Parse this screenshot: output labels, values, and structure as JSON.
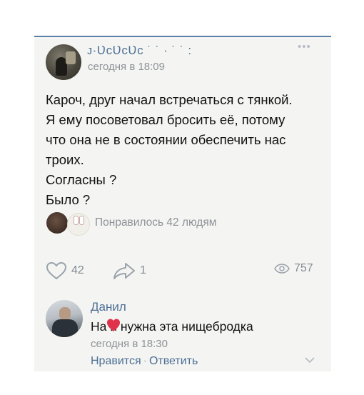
{
  "post": {
    "author": "ᴊ·ƲcƲcƲc ˙  ˙ · ˙ ˙ :",
    "time": "сегодня в 18:09",
    "more_icon": "ellipsis-icon",
    "lines": [
      "Кароч, друг начал встречаться с тянкой.",
      "Я ему посоветовал бросить её, потому",
      "что она не в состоянии обеспечить нас",
      "троих.",
      "Согласны ?",
      "Было ?"
    ],
    "liked_by": "Понравилось 42 людям"
  },
  "actions": {
    "likes": "42",
    "shares": "1",
    "views": "757"
  },
  "comment": {
    "author": "Данил",
    "text": "На   й нужна эта нищебродка",
    "time": "сегодня в 18:30",
    "like_label": "Нравится",
    "separator": "·",
    "reply_label": "Ответить"
  },
  "colors": {
    "link": "#4c6f95",
    "muted": "#8d9298",
    "background": "#f4f5f2",
    "heart": "#e0324b"
  }
}
